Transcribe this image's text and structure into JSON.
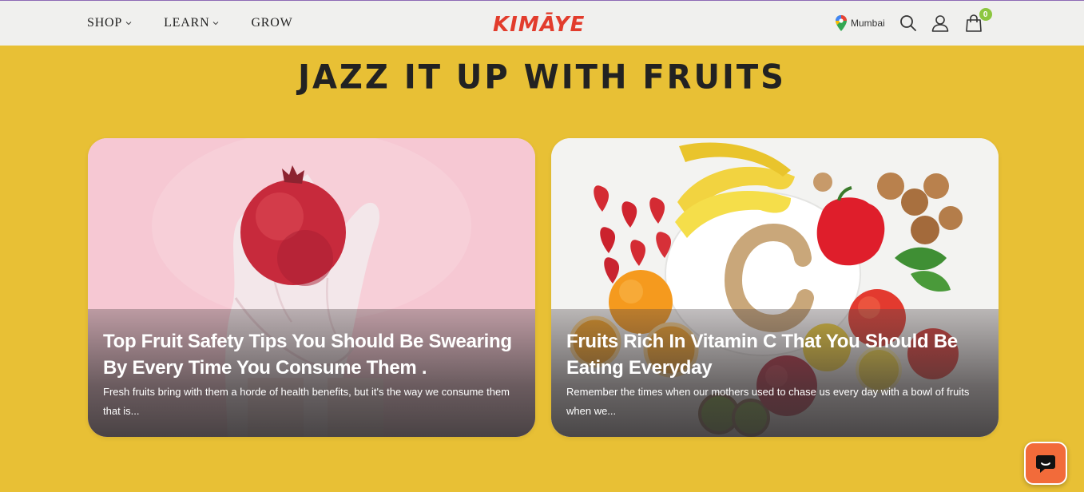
{
  "header": {
    "nav": [
      {
        "label": "SHOP",
        "has_dropdown": true
      },
      {
        "label": "LEARN",
        "has_dropdown": true
      },
      {
        "label": "GROW",
        "has_dropdown": false
      }
    ],
    "logo_text": "KIMĀYE",
    "location": "Mumbai",
    "cart_count": "0",
    "icons": [
      "map-pin-icon",
      "search-icon",
      "user-icon",
      "shopping-bag-icon"
    ]
  },
  "section": {
    "title": "JAZZ IT UP WITH FRUITS"
  },
  "cards": [
    {
      "title": "Top Fruit Safety Tips You Should Be Swearing By Every Time You Consume Them .",
      "excerpt": "Fresh fruits bring with them a horde of health benefits, but it's the way we consume them that is...",
      "image": "pomegranate-in-gloved-hands"
    },
    {
      "title": "Fruits Rich In Vitamin C That You Should Be Eating Everyday",
      "excerpt": "Remember the times when our mothers used to chase us every day with a bowl of fruits when we...",
      "image": "vitamin-c-fruits-arrangement"
    }
  ],
  "chat": {
    "icon": "chat-icon"
  },
  "colors": {
    "page_bg": "#e8c035",
    "header_bg": "#f0f0ee",
    "logo_red": "#e23c2c",
    "cart_badge": "#8cc63f",
    "chat_button": "#f26b3a"
  }
}
